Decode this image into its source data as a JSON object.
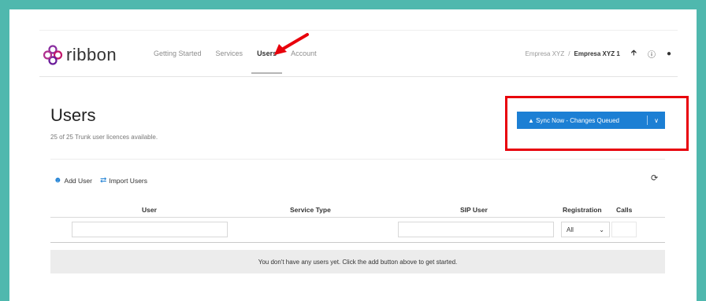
{
  "brand": {
    "name": "ribbon"
  },
  "nav": {
    "items": [
      {
        "label": "Getting Started",
        "active": false
      },
      {
        "label": "Services",
        "active": false
      },
      {
        "label": "Users",
        "active": true
      },
      {
        "label": "Account",
        "active": false
      }
    ]
  },
  "header": {
    "breadcrumb_parent": "Empresa XYZ",
    "breadcrumb_separator": "/",
    "breadcrumb_current": "Empresa XYZ 1",
    "icons": [
      "upload-icon",
      "help-icon",
      "user-icon"
    ]
  },
  "page": {
    "title": "Users",
    "subtitle": "25 of 25 Trunk user licences available."
  },
  "sync": {
    "label": "Sync Now - Changes Queued",
    "icon": "warning-icon",
    "color": "#1c7fd4",
    "highlight_color": "#e8000b"
  },
  "actions": {
    "add_user": "Add User",
    "import_users": "Import Users"
  },
  "table": {
    "columns": [
      "User",
      "Service Type",
      "SIP User",
      "Registration",
      "Calls"
    ],
    "registration_filter": "All",
    "empty_message": "You don't have any users yet. Click the add button above to get started."
  }
}
